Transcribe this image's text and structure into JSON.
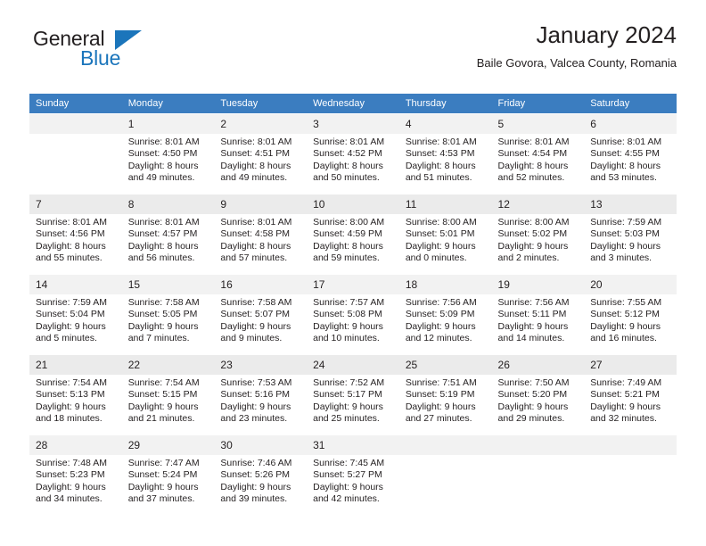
{
  "brand": {
    "name_top": "General",
    "name_bottom": "Blue",
    "accent_color": "#1b75bb"
  },
  "header": {
    "title": "January 2024",
    "subtitle": "Baile Govora, Valcea County, Romania"
  },
  "calendar": {
    "header_bg": "#3b7dc0",
    "weekdays": [
      "Sunday",
      "Monday",
      "Tuesday",
      "Wednesday",
      "Thursday",
      "Friday",
      "Saturday"
    ],
    "weeks": [
      [
        {
          "day": "",
          "sunrise": "",
          "sunset": "",
          "daylight1": "",
          "daylight2": ""
        },
        {
          "day": "1",
          "sunrise": "Sunrise: 8:01 AM",
          "sunset": "Sunset: 4:50 PM",
          "daylight1": "Daylight: 8 hours",
          "daylight2": "and 49 minutes."
        },
        {
          "day": "2",
          "sunrise": "Sunrise: 8:01 AM",
          "sunset": "Sunset: 4:51 PM",
          "daylight1": "Daylight: 8 hours",
          "daylight2": "and 49 minutes."
        },
        {
          "day": "3",
          "sunrise": "Sunrise: 8:01 AM",
          "sunset": "Sunset: 4:52 PM",
          "daylight1": "Daylight: 8 hours",
          "daylight2": "and 50 minutes."
        },
        {
          "day": "4",
          "sunrise": "Sunrise: 8:01 AM",
          "sunset": "Sunset: 4:53 PM",
          "daylight1": "Daylight: 8 hours",
          "daylight2": "and 51 minutes."
        },
        {
          "day": "5",
          "sunrise": "Sunrise: 8:01 AM",
          "sunset": "Sunset: 4:54 PM",
          "daylight1": "Daylight: 8 hours",
          "daylight2": "and 52 minutes."
        },
        {
          "day": "6",
          "sunrise": "Sunrise: 8:01 AM",
          "sunset": "Sunset: 4:55 PM",
          "daylight1": "Daylight: 8 hours",
          "daylight2": "and 53 minutes."
        }
      ],
      [
        {
          "day": "7",
          "sunrise": "Sunrise: 8:01 AM",
          "sunset": "Sunset: 4:56 PM",
          "daylight1": "Daylight: 8 hours",
          "daylight2": "and 55 minutes."
        },
        {
          "day": "8",
          "sunrise": "Sunrise: 8:01 AM",
          "sunset": "Sunset: 4:57 PM",
          "daylight1": "Daylight: 8 hours",
          "daylight2": "and 56 minutes."
        },
        {
          "day": "9",
          "sunrise": "Sunrise: 8:01 AM",
          "sunset": "Sunset: 4:58 PM",
          "daylight1": "Daylight: 8 hours",
          "daylight2": "and 57 minutes."
        },
        {
          "day": "10",
          "sunrise": "Sunrise: 8:00 AM",
          "sunset": "Sunset: 4:59 PM",
          "daylight1": "Daylight: 8 hours",
          "daylight2": "and 59 minutes."
        },
        {
          "day": "11",
          "sunrise": "Sunrise: 8:00 AM",
          "sunset": "Sunset: 5:01 PM",
          "daylight1": "Daylight: 9 hours",
          "daylight2": "and 0 minutes."
        },
        {
          "day": "12",
          "sunrise": "Sunrise: 8:00 AM",
          "sunset": "Sunset: 5:02 PM",
          "daylight1": "Daylight: 9 hours",
          "daylight2": "and 2 minutes."
        },
        {
          "day": "13",
          "sunrise": "Sunrise: 7:59 AM",
          "sunset": "Sunset: 5:03 PM",
          "daylight1": "Daylight: 9 hours",
          "daylight2": "and 3 minutes."
        }
      ],
      [
        {
          "day": "14",
          "sunrise": "Sunrise: 7:59 AM",
          "sunset": "Sunset: 5:04 PM",
          "daylight1": "Daylight: 9 hours",
          "daylight2": "and 5 minutes."
        },
        {
          "day": "15",
          "sunrise": "Sunrise: 7:58 AM",
          "sunset": "Sunset: 5:05 PM",
          "daylight1": "Daylight: 9 hours",
          "daylight2": "and 7 minutes."
        },
        {
          "day": "16",
          "sunrise": "Sunrise: 7:58 AM",
          "sunset": "Sunset: 5:07 PM",
          "daylight1": "Daylight: 9 hours",
          "daylight2": "and 9 minutes."
        },
        {
          "day": "17",
          "sunrise": "Sunrise: 7:57 AM",
          "sunset": "Sunset: 5:08 PM",
          "daylight1": "Daylight: 9 hours",
          "daylight2": "and 10 minutes."
        },
        {
          "day": "18",
          "sunrise": "Sunrise: 7:56 AM",
          "sunset": "Sunset: 5:09 PM",
          "daylight1": "Daylight: 9 hours",
          "daylight2": "and 12 minutes."
        },
        {
          "day": "19",
          "sunrise": "Sunrise: 7:56 AM",
          "sunset": "Sunset: 5:11 PM",
          "daylight1": "Daylight: 9 hours",
          "daylight2": "and 14 minutes."
        },
        {
          "day": "20",
          "sunrise": "Sunrise: 7:55 AM",
          "sunset": "Sunset: 5:12 PM",
          "daylight1": "Daylight: 9 hours",
          "daylight2": "and 16 minutes."
        }
      ],
      [
        {
          "day": "21",
          "sunrise": "Sunrise: 7:54 AM",
          "sunset": "Sunset: 5:13 PM",
          "daylight1": "Daylight: 9 hours",
          "daylight2": "and 18 minutes."
        },
        {
          "day": "22",
          "sunrise": "Sunrise: 7:54 AM",
          "sunset": "Sunset: 5:15 PM",
          "daylight1": "Daylight: 9 hours",
          "daylight2": "and 21 minutes."
        },
        {
          "day": "23",
          "sunrise": "Sunrise: 7:53 AM",
          "sunset": "Sunset: 5:16 PM",
          "daylight1": "Daylight: 9 hours",
          "daylight2": "and 23 minutes."
        },
        {
          "day": "24",
          "sunrise": "Sunrise: 7:52 AM",
          "sunset": "Sunset: 5:17 PM",
          "daylight1": "Daylight: 9 hours",
          "daylight2": "and 25 minutes."
        },
        {
          "day": "25",
          "sunrise": "Sunrise: 7:51 AM",
          "sunset": "Sunset: 5:19 PM",
          "daylight1": "Daylight: 9 hours",
          "daylight2": "and 27 minutes."
        },
        {
          "day": "26",
          "sunrise": "Sunrise: 7:50 AM",
          "sunset": "Sunset: 5:20 PM",
          "daylight1": "Daylight: 9 hours",
          "daylight2": "and 29 minutes."
        },
        {
          "day": "27",
          "sunrise": "Sunrise: 7:49 AM",
          "sunset": "Sunset: 5:21 PM",
          "daylight1": "Daylight: 9 hours",
          "daylight2": "and 32 minutes."
        }
      ],
      [
        {
          "day": "28",
          "sunrise": "Sunrise: 7:48 AM",
          "sunset": "Sunset: 5:23 PM",
          "daylight1": "Daylight: 9 hours",
          "daylight2": "and 34 minutes."
        },
        {
          "day": "29",
          "sunrise": "Sunrise: 7:47 AM",
          "sunset": "Sunset: 5:24 PM",
          "daylight1": "Daylight: 9 hours",
          "daylight2": "and 37 minutes."
        },
        {
          "day": "30",
          "sunrise": "Sunrise: 7:46 AM",
          "sunset": "Sunset: 5:26 PM",
          "daylight1": "Daylight: 9 hours",
          "daylight2": "and 39 minutes."
        },
        {
          "day": "31",
          "sunrise": "Sunrise: 7:45 AM",
          "sunset": "Sunset: 5:27 PM",
          "daylight1": "Daylight: 9 hours",
          "daylight2": "and 42 minutes."
        },
        {
          "day": "",
          "sunrise": "",
          "sunset": "",
          "daylight1": "",
          "daylight2": ""
        },
        {
          "day": "",
          "sunrise": "",
          "sunset": "",
          "daylight1": "",
          "daylight2": ""
        },
        {
          "day": "",
          "sunrise": "",
          "sunset": "",
          "daylight1": "",
          "daylight2": ""
        }
      ]
    ]
  }
}
